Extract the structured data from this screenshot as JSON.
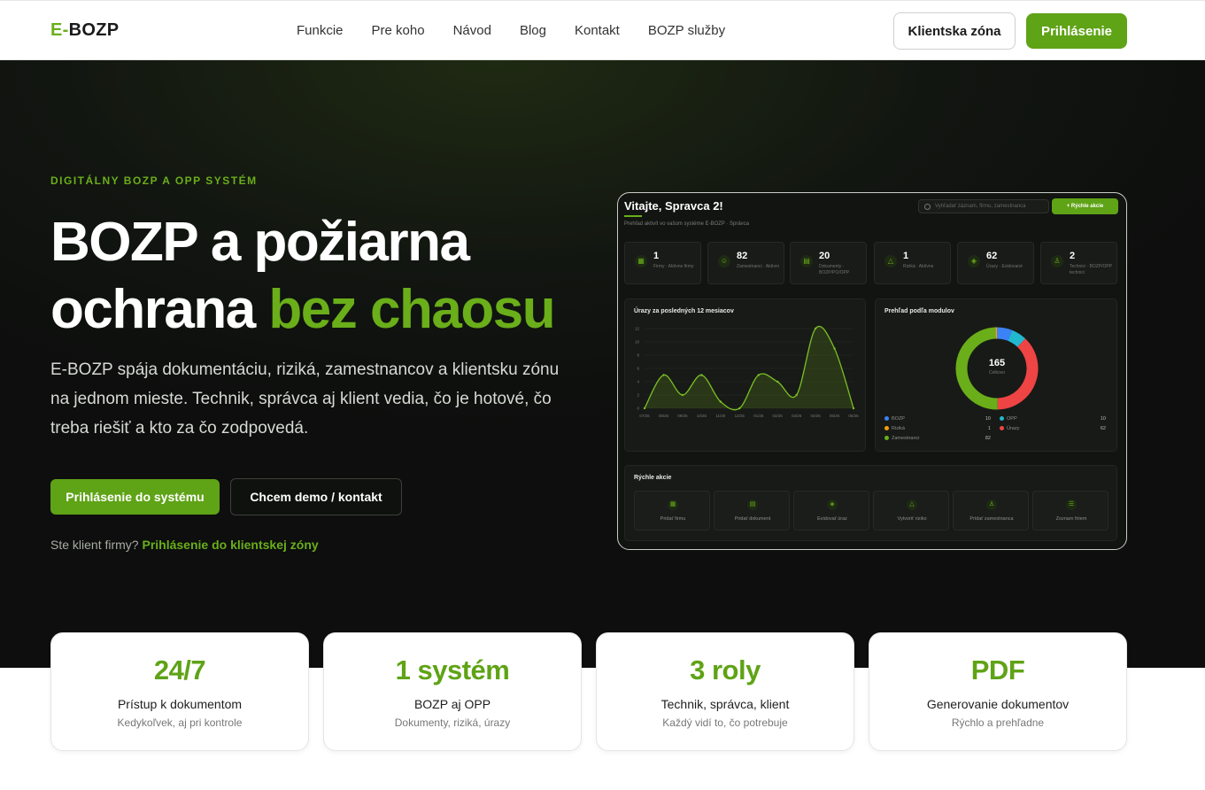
{
  "nav": {
    "logo_prefix": "E-",
    "logo_main": "BOZP",
    "links": [
      "Funkcie",
      "Pre koho",
      "Návod",
      "Blog",
      "Kontakt",
      "BOZP služby"
    ],
    "client_zone_label": "Klientska zóna",
    "login_label": "Prihlásenie"
  },
  "hero": {
    "eyebrow": "DIGITÁLNY BOZP A OPP SYSTÉM",
    "title_line1": "BOZP a požiarna",
    "title_line2_plain": "ochrana ",
    "title_line2_accent": "bez chaosu",
    "lead": "E-BOZP spája dokumentáciu, riziká, zamestnancov a klientsku zónu na jednom mieste. Technik, správca aj klient vedia, čo je hotové, čo treba riešiť a kto za čo zodpovedá.",
    "cta_primary": "Prihlásenie do systému",
    "cta_secondary": "Chcem demo / kontakt",
    "client_note": "Ste klient firmy?",
    "client_link": "Prihlásenie do klientskej zóny"
  },
  "dashboard": {
    "title": "Vitajte, Spravca 2!",
    "subtitle": "Prehľad aktivít vo vašom systéme E-BOZP · Správca",
    "search_placeholder": "Vyhľadať záznam, firmu, zamestnanca",
    "quick_action_label": "+ Rýchle akcie",
    "stats": [
      {
        "value": "1",
        "label": "Firmy · Aktívne firmy",
        "icon": "building-icon"
      },
      {
        "value": "82",
        "label": "Zamestnanci · Aktívni",
        "icon": "people-icon"
      },
      {
        "value": "20",
        "label": "Dokumenty · BOZP/PO/OPP",
        "icon": "document-icon"
      },
      {
        "value": "1",
        "label": "Riziká · Aktívne",
        "icon": "warning-icon"
      },
      {
        "value": "62",
        "label": "Úrazy · Evidované",
        "icon": "shield-icon"
      },
      {
        "value": "2",
        "label": "Technici · BOZP/OPP technici",
        "icon": "user-icon"
      }
    ],
    "injury_chart_title": "Úrazy za posledných 12 mesiacov",
    "module_chart_title": "Prehľad podľa modulov",
    "donut_total": "165",
    "donut_total_label": "Celkovo",
    "quick_actions_title": "Rýchle akcie",
    "quick_actions": [
      {
        "label": "Pridať firmu",
        "icon": "building-icon"
      },
      {
        "label": "Pridať dokument",
        "icon": "document-icon"
      },
      {
        "label": "Evidovať úraz",
        "icon": "shield-icon"
      },
      {
        "label": "Vytvoriť riziko",
        "icon": "warning-icon"
      },
      {
        "label": "Pridať zamestnanca",
        "icon": "user-icon"
      },
      {
        "label": "Zoznam firiem",
        "icon": "list-icon"
      }
    ]
  },
  "chart_data": [
    {
      "type": "area",
      "title": "Úrazy za posledných 12 mesiacov",
      "x": [
        "07/25",
        "08/25",
        "09/25",
        "10/25",
        "11/25",
        "12/25",
        "01/26",
        "02/26",
        "03/26",
        "04/26",
        "05/26",
        "06/26"
      ],
      "series": [
        {
          "values": [
            0,
            5,
            2,
            5,
            1,
            0,
            5,
            4,
            2,
            12,
            9,
            0
          ]
        }
      ],
      "y_ticks": [
        "0",
        "2",
        "4",
        "6",
        "8",
        "10",
        "12"
      ],
      "ylim": [
        0,
        12
      ],
      "color": "#7bbf24"
    },
    {
      "type": "pie",
      "title": "Prehľad podľa modulov",
      "categories": [
        "BOZP",
        "OPP",
        "Riziká",
        "Úrazy",
        "Zamestnanci"
      ],
      "values": [
        10,
        10,
        1,
        62,
        82
      ],
      "colors": [
        "#3b82f6",
        "#22b8cf",
        "#f59e0b",
        "#ef4444",
        "#6aae1a"
      ]
    }
  ],
  "features": [
    {
      "big": "24/7",
      "title": "Prístup k dokumentom",
      "sub": "Kedykoľvek, aj pri kontrole"
    },
    {
      "big": "1 systém",
      "title": "BOZP aj OPP",
      "sub": "Dokumenty, riziká, úrazy"
    },
    {
      "big": "3 roly",
      "title": "Technik, správca, klient",
      "sub": "Každý vidí to, čo potrebuje"
    },
    {
      "big": "PDF",
      "title": "Generovanie dokumentov",
      "sub": "Rýchlo a prehľadne"
    }
  ]
}
